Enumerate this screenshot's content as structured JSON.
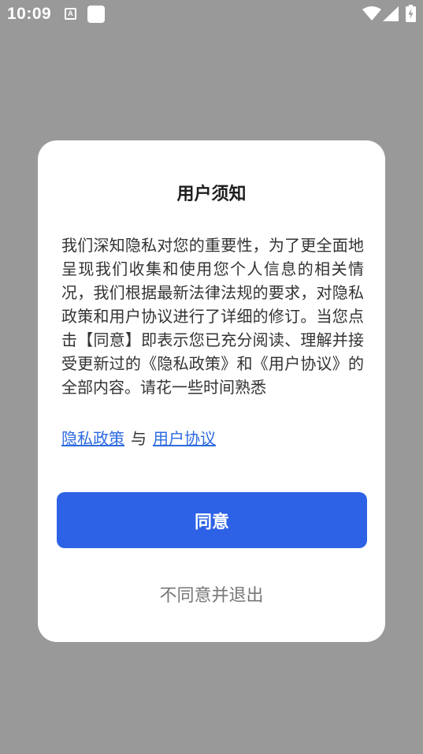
{
  "status_bar": {
    "time": "10:09",
    "notification_icon_letter": "A",
    "icons": [
      "notification-a-icon",
      "notification-square-icon",
      "wifi-icon",
      "cellular-signal-icon",
      "battery-charging-icon"
    ]
  },
  "dialog": {
    "title": "用户须知",
    "body": "我们深知隐私对您的重要性，为了更全面地呈现我们收集和使用您个人信息的相关情况，我们根据最新法律法规的要求，对隐私政策和用户协议进行了详细的修订。当您点击【同意】即表示您已充分阅读、理解并接受更新过的《隐私政策》和《用户协议》的全部内容。请花一些时间熟悉",
    "privacy_link": "隐私政策",
    "link_separator": "与",
    "terms_link": "用户协议",
    "agree_label": "同意",
    "decline_label": "不同意并退出"
  },
  "colors": {
    "scrim": "#999999",
    "dialog_bg": "#ffffff",
    "accent": "#2d62e6",
    "link": "#2d6ae0"
  }
}
